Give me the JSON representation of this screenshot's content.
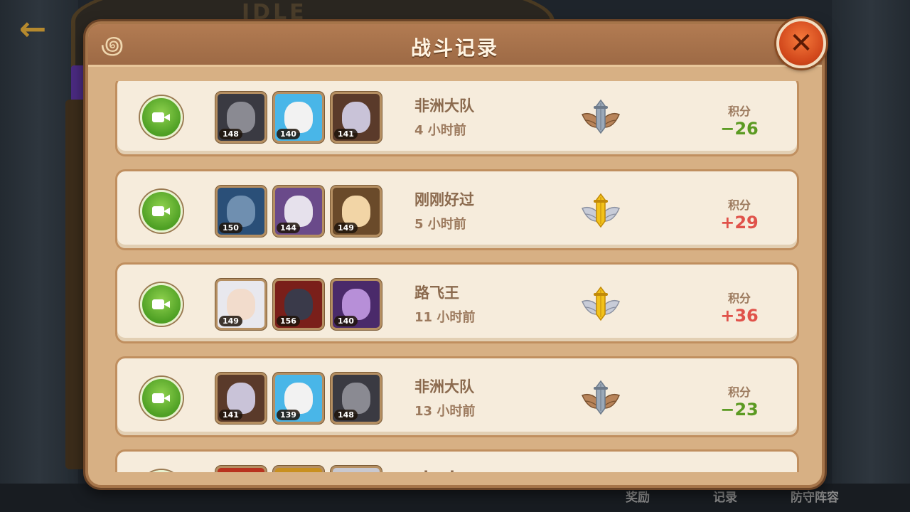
{
  "header": {
    "title": "战斗记录"
  },
  "background": {
    "back_icon": "←",
    "title_deco": "IDLE",
    "bottom_labels": [
      "奖励",
      "记录",
      "防守阵容"
    ]
  },
  "close": {
    "glyph": "✕"
  },
  "score_label": "积分",
  "records": [
    {
      "opponent": "非洲大队",
      "time_ago": "4  小时前",
      "score": "−26",
      "score_sign": "neg",
      "rank": "silver",
      "heroes": [
        {
          "level": "148",
          "bg": "#3a3a42",
          "face": "#8a8a92"
        },
        {
          "level": "140",
          "bg": "#49b6e8",
          "face": "#f2f2f2"
        },
        {
          "level": "141",
          "bg": "#5a3a2a",
          "face": "#c9c3d8"
        }
      ]
    },
    {
      "opponent": "刚刚好过",
      "time_ago": "5  小时前",
      "score": "+29",
      "score_sign": "pos",
      "rank": "gold",
      "heroes": [
        {
          "level": "150",
          "bg": "#2a4f78",
          "face": "#6f8fb0"
        },
        {
          "level": "144",
          "bg": "#6a4a8a",
          "face": "#e6e1ec"
        },
        {
          "level": "149",
          "bg": "#6a4a2a",
          "face": "#f2d5a6"
        }
      ]
    },
    {
      "opponent": "路飞王",
      "time_ago": "11  小时前",
      "score": "+36",
      "score_sign": "pos",
      "rank": "gold",
      "heroes": [
        {
          "level": "149",
          "bg": "#e8e8ee",
          "face": "#f2dccc"
        },
        {
          "level": "156",
          "bg": "#7a1f1a",
          "face": "#3a3a4a"
        },
        {
          "level": "140",
          "bg": "#4a2a6a",
          "face": "#b78fd8"
        }
      ]
    },
    {
      "opponent": "非洲大队",
      "time_ago": "13  小时前",
      "score": "−23",
      "score_sign": "neg",
      "rank": "silver",
      "heroes": [
        {
          "level": "141",
          "bg": "#5a3a2a",
          "face": "#c9c3d8"
        },
        {
          "level": "139",
          "bg": "#49b6e8",
          "face": "#f2f2f2"
        },
        {
          "level": "148",
          "bg": "#3a3a42",
          "face": "#8a8a92"
        }
      ]
    },
    {
      "opponent": "skrskr",
      "time_ago": "",
      "score": "",
      "score_sign": "neg",
      "rank": "silver",
      "heroes": [
        {
          "level": "",
          "bg": "#b8321e",
          "face": "#e8c060"
        },
        {
          "level": "",
          "bg": "#c89020",
          "face": "#4ab0a0"
        },
        {
          "level": "",
          "bg": "#c8c8d0",
          "face": "#505060"
        }
      ]
    }
  ]
}
